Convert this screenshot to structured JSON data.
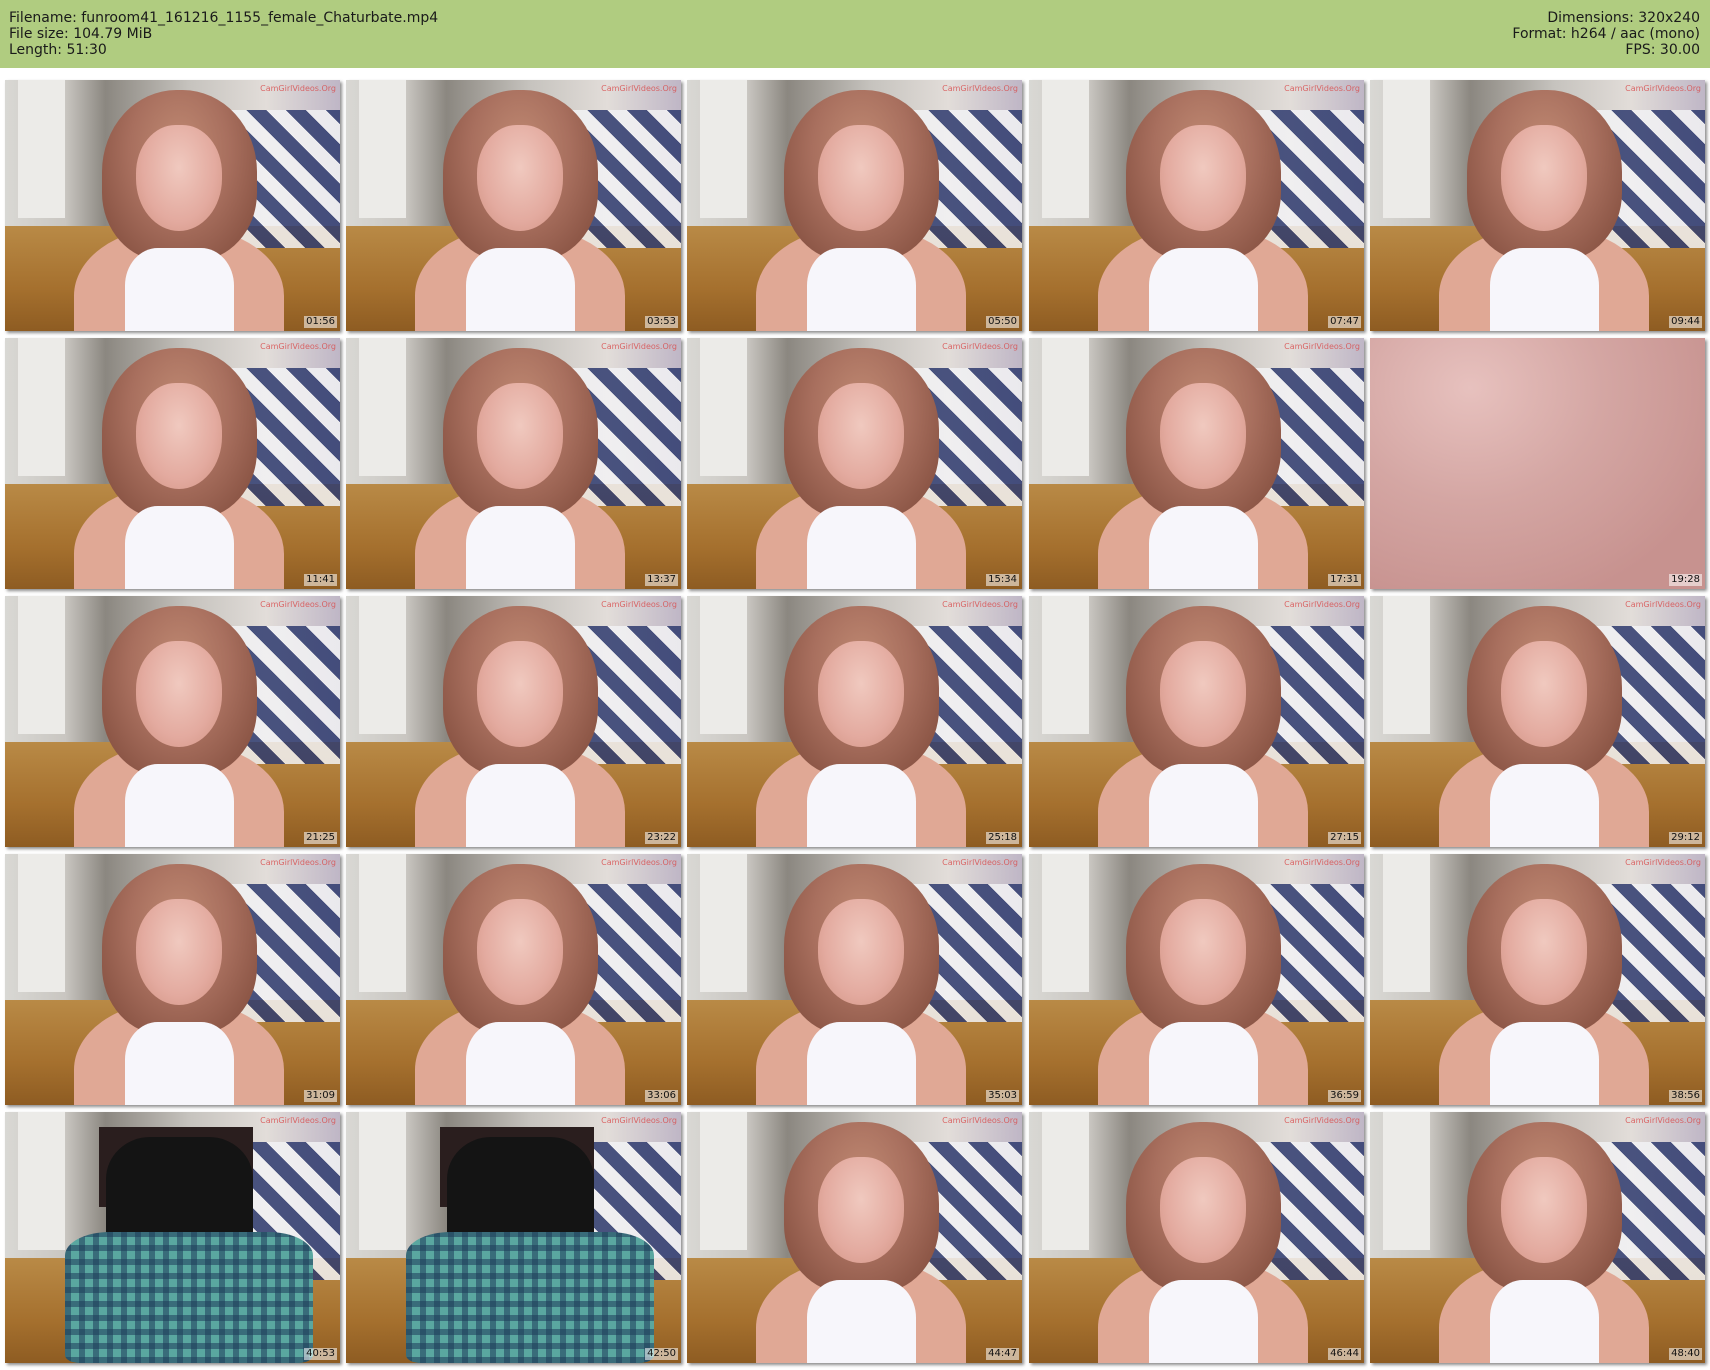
{
  "header": {
    "filename": "Filename: funroom41_161216_1155_female_Chaturbate.mp4",
    "filesize": "File size: 104.79 MiB",
    "length": "Length: 51:30",
    "dimensions": "Dimensions: 320x240",
    "format": "Format: h264 / aac (mono)",
    "fps": "FPS: 30.00"
  },
  "colors": {
    "header_bg": "#b0cc80"
  },
  "thumbnails": [
    {
      "time": "01:56",
      "scene": "person",
      "watermark": "CamGirlVideos.Org"
    },
    {
      "time": "03:53",
      "scene": "person",
      "watermark": "CamGirlVideos.Org"
    },
    {
      "time": "05:50",
      "scene": "person",
      "watermark": "CamGirlVideos.Org"
    },
    {
      "time": "07:47",
      "scene": "person",
      "watermark": "CamGirlVideos.Org"
    },
    {
      "time": "09:44",
      "scene": "person",
      "watermark": "CamGirlVideos.Org"
    },
    {
      "time": "11:41",
      "scene": "person",
      "watermark": "CamGirlVideos.Org"
    },
    {
      "time": "13:37",
      "scene": "person",
      "watermark": "CamGirlVideos.Org"
    },
    {
      "time": "15:34",
      "scene": "person",
      "watermark": "CamGirlVideos.Org"
    },
    {
      "time": "17:31",
      "scene": "person",
      "watermark": "CamGirlVideos.Org"
    },
    {
      "time": "19:28",
      "scene": "skin",
      "watermark": ""
    },
    {
      "time": "21:25",
      "scene": "person",
      "watermark": "CamGirlVideos.Org"
    },
    {
      "time": "23:22",
      "scene": "person",
      "watermark": "CamGirlVideos.Org"
    },
    {
      "time": "25:18",
      "scene": "person",
      "watermark": "CamGirlVideos.Org"
    },
    {
      "time": "27:15",
      "scene": "person",
      "watermark": "CamGirlVideos.Org"
    },
    {
      "time": "29:12",
      "scene": "person",
      "watermark": "CamGirlVideos.Org"
    },
    {
      "time": "31:09",
      "scene": "person",
      "watermark": "CamGirlVideos.Org"
    },
    {
      "time": "33:06",
      "scene": "person",
      "watermark": "CamGirlVideos.Org"
    },
    {
      "time": "35:03",
      "scene": "person",
      "watermark": "CamGirlVideos.Org"
    },
    {
      "time": "36:59",
      "scene": "person",
      "watermark": "CamGirlVideos.Org"
    },
    {
      "time": "38:56",
      "scene": "person",
      "watermark": "CamGirlVideos.Org"
    },
    {
      "time": "40:53",
      "scene": "chair",
      "watermark": "CamGirlVideos.Org"
    },
    {
      "time": "42:50",
      "scene": "chair",
      "watermark": "CamGirlVideos.Org"
    },
    {
      "time": "44:47",
      "scene": "person",
      "watermark": "CamGirlVideos.Org"
    },
    {
      "time": "46:44",
      "scene": "person",
      "watermark": "CamGirlVideos.Org"
    },
    {
      "time": "48:40",
      "scene": "person",
      "watermark": "CamGirlVideos.Org"
    }
  ]
}
